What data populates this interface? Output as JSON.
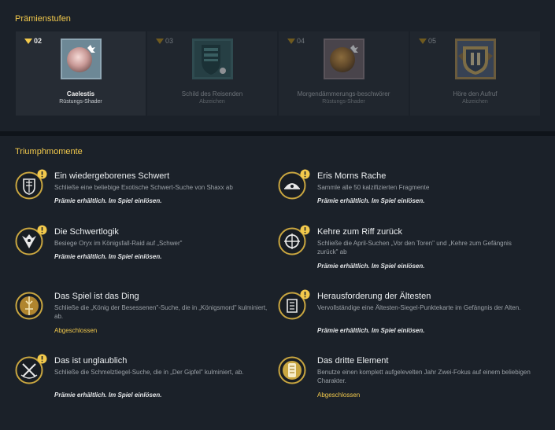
{
  "rewards": {
    "title": "Prämienstufen",
    "tiers": [
      {
        "num": "02",
        "name": "Caelestis",
        "type": "Rüstungs-Shader",
        "icon": "shader-icon",
        "state": "active"
      },
      {
        "num": "03",
        "name": "Schild des Reisenden",
        "type": "Abzeichen",
        "icon": "emblem-icon",
        "state": "locked"
      },
      {
        "num": "04",
        "name": "Morgendämmerungs-beschwörer",
        "type": "Rüstungs-Shader",
        "icon": "shader-icon",
        "state": "locked"
      },
      {
        "num": "05",
        "name": "Höre den Aufruf",
        "type": "Abzeichen",
        "icon": "emblem-icon",
        "state": "locked"
      }
    ]
  },
  "triumphs": {
    "title": "Triumphmomente",
    "items": [
      {
        "title": "Ein wiedergeborenes Schwert",
        "desc": "Schließe eine beliebige Exotische Schwert-Suche von Shaxx ab",
        "status": "Prämie erhältlich. Im Spiel einlösen.",
        "done": false,
        "icon": "sword-triumph-icon"
      },
      {
        "title": "Eris Morns Rache",
        "desc": "Sammle alle 50 kalzifizierten Fragmente",
        "status": "Prämie erhältlich. Im Spiel einlösen.",
        "done": false,
        "icon": "eris-triumph-icon"
      },
      {
        "title": "Die Schwertlogik",
        "desc": "Besiege Oryx im Königsfall-Raid auf „Schwer\"",
        "status": "Prämie erhältlich. Im Spiel einlösen.",
        "done": false,
        "icon": "oryx-triumph-icon"
      },
      {
        "title": "Kehre zum Riff zurück",
        "desc": "Schließe die April-Suchen „Vor den Toren\" und „Kehre zum Gefängnis zurück\" ab",
        "status": "Prämie erhältlich. Im Spiel einlösen.",
        "done": false,
        "icon": "reef-triumph-icon"
      },
      {
        "title": "Das Spiel ist das Ding",
        "desc": "Schließe die „König der Besessenen\"-Suche, die in „Königsmord\" kulminiert, ab.",
        "status": "Abgeschlossen",
        "done": true,
        "icon": "king-triumph-icon"
      },
      {
        "title": "Herausforderung der Ältesten",
        "desc": "Vervollständige eine Ältesten-Siegel-Punktekarte im Gefängnis der Alten.",
        "status": "Prämie erhältlich. Im Spiel einlösen.",
        "done": false,
        "icon": "elders-triumph-icon"
      },
      {
        "title": "Das ist unglaublich",
        "desc": "Schließe die Schmelztiegel-Suche, die in „Der Gipfel\" kulminiert, ab.",
        "status": "Prämie erhältlich. Im Spiel einlösen.",
        "done": false,
        "icon": "crucible-triumph-icon"
      },
      {
        "title": "Das dritte Element",
        "desc": "Benutze einen komplett aufgelevelten Jahr Zwei-Fokus auf einem beliebigen Charakter.",
        "status": "Abgeschlossen",
        "done": true,
        "icon": "focus-triumph-icon"
      }
    ]
  },
  "colors": {
    "accent": "#f2c94c",
    "panel": "#1b2129",
    "background": "#0f141a"
  }
}
